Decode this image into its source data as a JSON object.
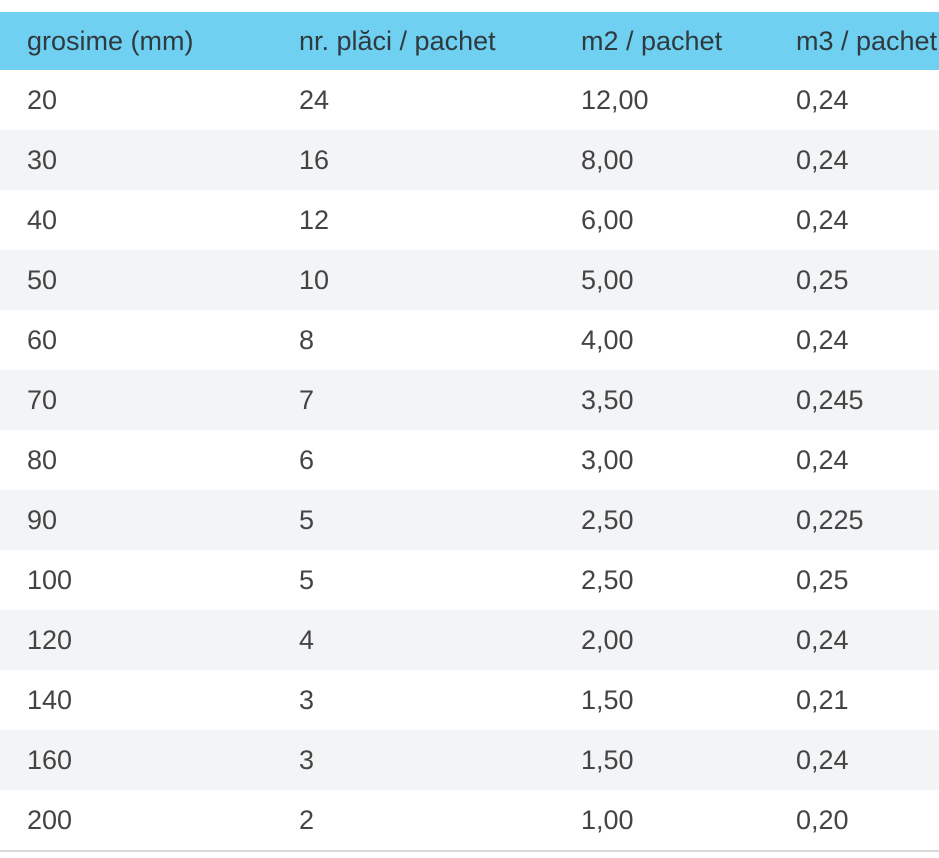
{
  "table": {
    "headers": [
      "grosime (mm)",
      "nr. plăci / pachet",
      "m2 / pachet",
      "m3 / pachet"
    ],
    "rows": [
      [
        "20",
        "24",
        "12,00",
        "0,24"
      ],
      [
        "30",
        "16",
        "8,00",
        "0,24"
      ],
      [
        "40",
        "12",
        "6,00",
        "0,24"
      ],
      [
        "50",
        "10",
        "5,00",
        "0,25"
      ],
      [
        "60",
        "8",
        "4,00",
        "0,24"
      ],
      [
        "70",
        "7",
        "3,50",
        "0,245"
      ],
      [
        "80",
        "6",
        "3,00",
        "0,24"
      ],
      [
        "90",
        "5",
        "2,50",
        "0,225"
      ],
      [
        "100",
        "5",
        "2,50",
        "0,25"
      ],
      [
        "120",
        "4",
        "2,00",
        "0,24"
      ],
      [
        "140",
        "3",
        "1,50",
        "0,21"
      ],
      [
        "160",
        "3",
        "1,50",
        "0,24"
      ],
      [
        "200",
        "2",
        "1,00",
        "0,20"
      ]
    ]
  },
  "colors": {
    "header_bg": "#6fd0f2",
    "stripe_bg": "#f3f4f6",
    "text": "#444444"
  }
}
